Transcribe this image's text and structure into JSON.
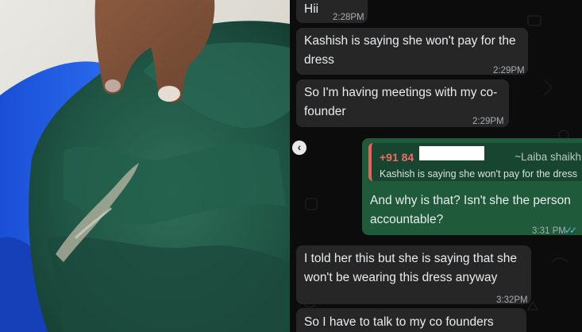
{
  "photo": {
    "description_icon": "dress-photo"
  },
  "messages": [
    {
      "text": "Hii",
      "time": "2:28PM"
    },
    {
      "line1": "Kashish is saying she won't pay for the",
      "line2": "dress",
      "time": "2:29PM"
    },
    {
      "line1": "So I'm having meetings with my co-",
      "line2": "founder",
      "time": "2:29PM"
    },
    {
      "line1": "I told her this but she is saying that she",
      "line2": "won't be wearing this dress anyway",
      "time": "3:32PM"
    },
    {
      "text": "So I have to talk to my co founders"
    }
  ],
  "reply": {
    "quoted_sender": "+91 84",
    "quoted_alias": "~Laiba shaikh",
    "quoted_text": "Kashish is saying she won't pay for the dress",
    "line1": "And why is that?  Isn't she the person",
    "line2": "accountable?",
    "time": "3:31 PM",
    "read_ticks": "✓✓"
  },
  "nav": {
    "prev_icon": "‹"
  },
  "colors": {
    "outgoing_bubble": "#1f5a3a",
    "incoming_bubble": "#262626",
    "quote_accent": "#e6625e",
    "read_tick": "#53bdeb"
  }
}
